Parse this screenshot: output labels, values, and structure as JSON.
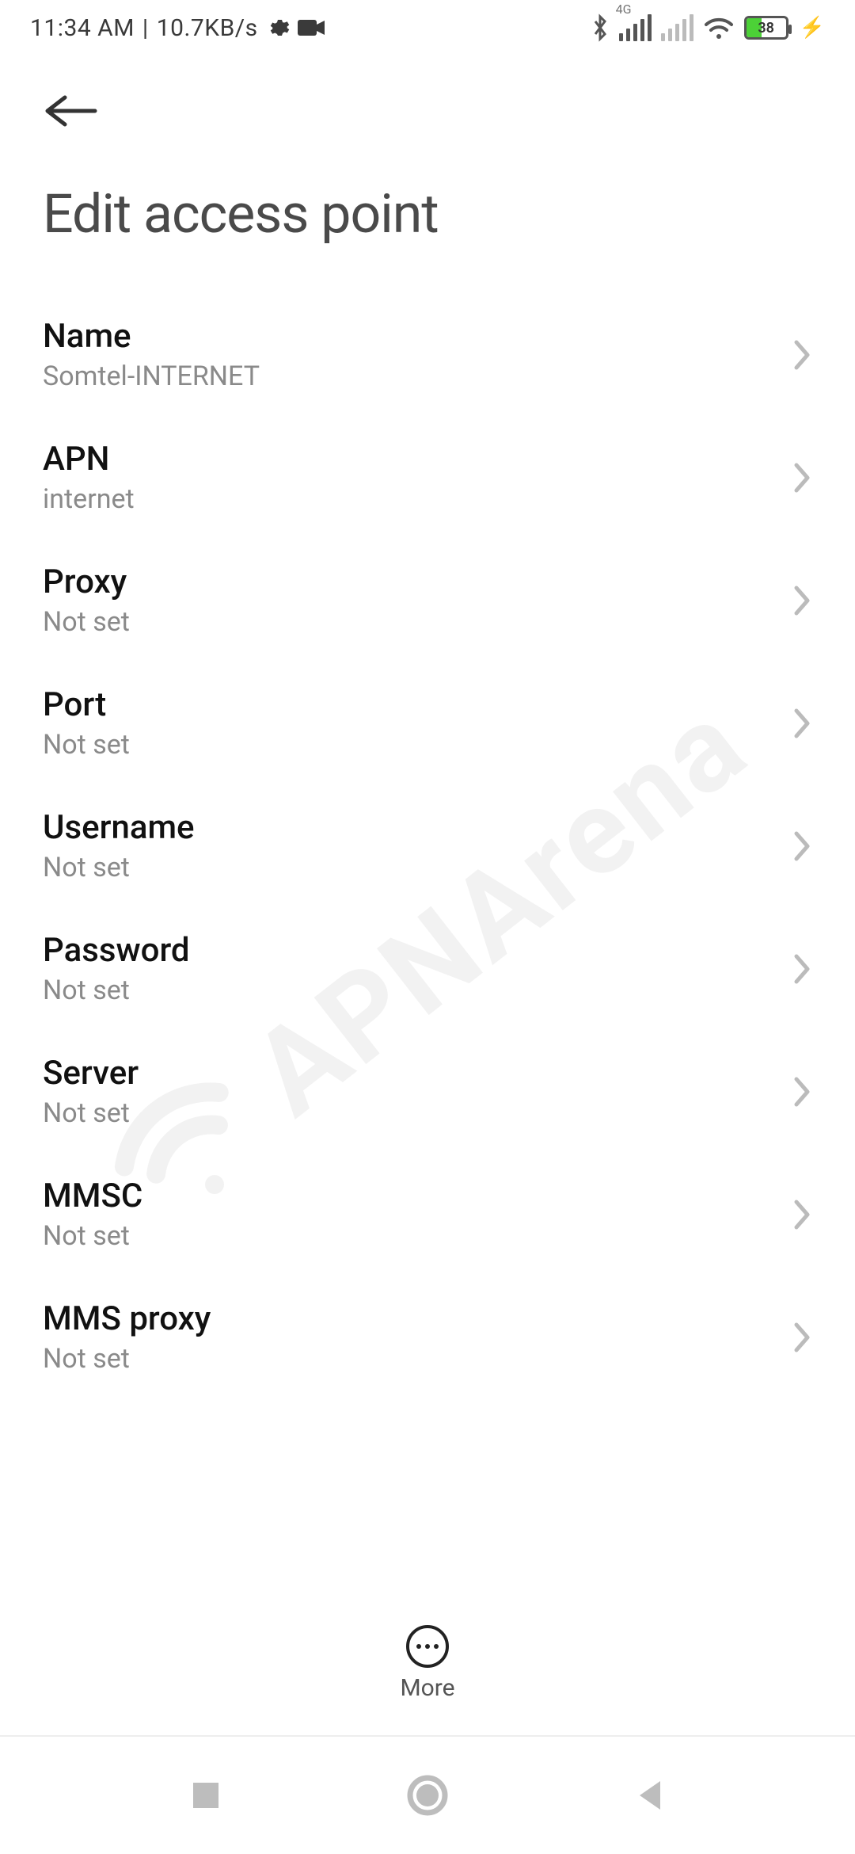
{
  "status": {
    "time": "11:34 AM",
    "separator": "|",
    "speed": "10.7KB/s",
    "signal1_label": "4G",
    "battery_percent": "38"
  },
  "header": {
    "title": "Edit access point"
  },
  "rows": [
    {
      "label": "Name",
      "value": "Somtel-INTERNET"
    },
    {
      "label": "APN",
      "value": "internet"
    },
    {
      "label": "Proxy",
      "value": "Not set"
    },
    {
      "label": "Port",
      "value": "Not set"
    },
    {
      "label": "Username",
      "value": "Not set"
    },
    {
      "label": "Password",
      "value": "Not set"
    },
    {
      "label": "Server",
      "value": "Not set"
    },
    {
      "label": "MMSC",
      "value": "Not set"
    },
    {
      "label": "MMS proxy",
      "value": "Not set"
    }
  ],
  "more": {
    "label": "More"
  },
  "watermark": {
    "text": "APNArena"
  }
}
